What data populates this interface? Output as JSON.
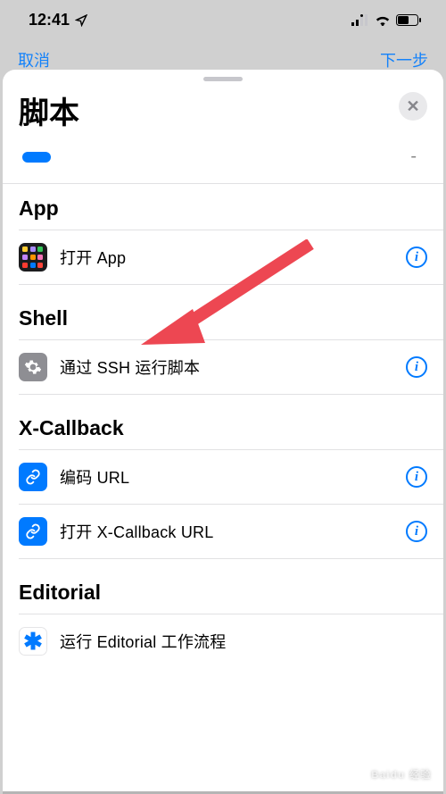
{
  "status_bar": {
    "time": "12:41"
  },
  "nav": {
    "cancel": "取消",
    "next": "下一步"
  },
  "sheet": {
    "title": "脚本",
    "close_label": "✕"
  },
  "sections": {
    "app": {
      "header": "App",
      "items": [
        {
          "label": "打开 App"
        }
      ]
    },
    "shell": {
      "header": "Shell",
      "items": [
        {
          "label": "通过 SSH 运行脚本"
        }
      ]
    },
    "xcallback": {
      "header": "X-Callback",
      "items": [
        {
          "label": "编码 URL"
        },
        {
          "label": "打开 X-Callback URL"
        }
      ]
    },
    "editorial": {
      "header": "Editorial",
      "items": [
        {
          "label": "运行 Editorial 工作流程"
        }
      ]
    }
  },
  "info_glyph": "i",
  "watermark": "Baidu 经验"
}
